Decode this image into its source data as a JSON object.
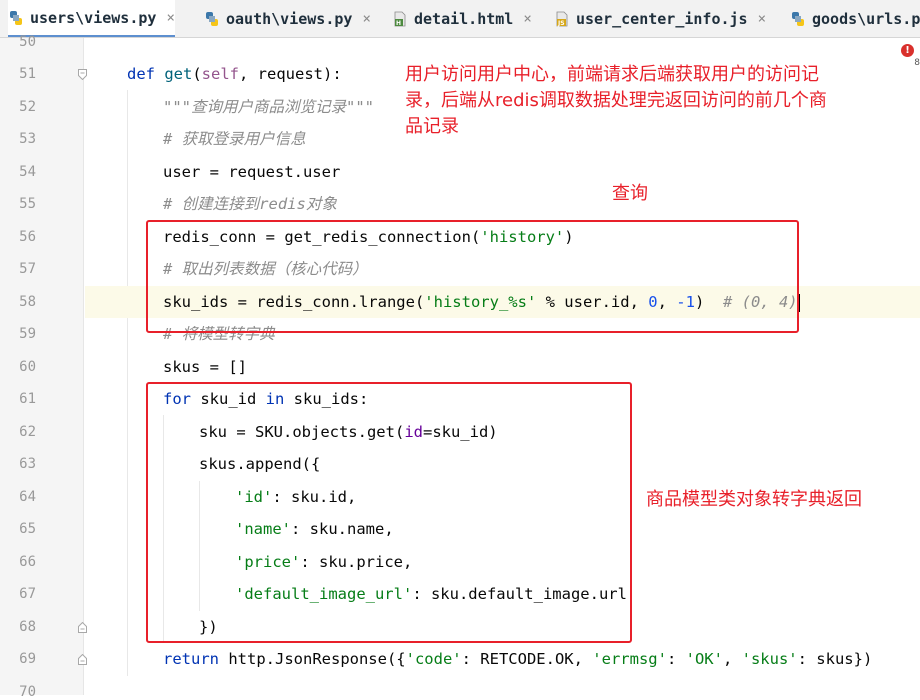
{
  "tabs": [
    {
      "label": "users\\views.py",
      "icon": "python-file-icon",
      "active": true
    },
    {
      "label": "oauth\\views.py",
      "icon": "python-file-icon"
    },
    {
      "label": "detail.html",
      "icon": "html-file-icon"
    },
    {
      "label": "user_center_info.js",
      "icon": "js-file-icon"
    },
    {
      "label": "goods\\urls.py",
      "icon": "python-file-icon"
    }
  ],
  "close_glyph": "×",
  "warning": {
    "glyph": "!",
    "count": "8"
  },
  "line_numbers": [
    "50",
    "51",
    "52",
    "53",
    "54",
    "55",
    "56",
    "57",
    "58",
    "59",
    "60",
    "61",
    "62",
    "63",
    "64",
    "65",
    "66",
    "67",
    "68",
    "69",
    "70"
  ],
  "code": {
    "l51": {
      "def": "def ",
      "name": "get",
      "p1": "(",
      "self": "self",
      "p2": ", request):"
    },
    "l52": {
      "doc": "\"\"\"查询用户商品浏览记录\"\"\""
    },
    "l53": {
      "cmt": "# 获取登录用户信息"
    },
    "l54": {
      "text": "user = request.user"
    },
    "l55": {
      "cmt": "# 创建连接到redis对象"
    },
    "l56": {
      "a": "redis_conn = get_redis_connection(",
      "s": "'history'",
      "b": ")"
    },
    "l57": {
      "cmt": "# 取出列表数据（核心代码）"
    },
    "l58": {
      "a": "sku_ids = redis_conn.lrange(",
      "s": "'history_%s'",
      "b": " % user.id, ",
      "n1": "0",
      "c": ", ",
      "n2": "-1",
      "d": ")  ",
      "cmt": "# (0, 4)"
    },
    "l59": {
      "cmt": "# 将模型转字典"
    },
    "l60": {
      "text": "skus = []"
    },
    "l61": {
      "kw1": "for",
      "a": " sku_id ",
      "kw2": "in",
      "b": " sku_ids:"
    },
    "l62": {
      "a": "sku = SKU.objects.get(",
      "p": "id",
      "b": "=sku_id)"
    },
    "l63": {
      "text": "skus.append({"
    },
    "l64": {
      "s": "'id'",
      "b": ": sku.id,"
    },
    "l65": {
      "s": "'name'",
      "b": ": sku.name,"
    },
    "l66": {
      "s": "'price'",
      "b": ": sku.price,"
    },
    "l67": {
      "s": "'default_image_url'",
      "b": ": sku.default_image.url"
    },
    "l68": {
      "text": "})"
    },
    "l69": {
      "kw": "return",
      "a": " http.JsonResponse({",
      "s1": "'code'",
      "b": ": RETCODE.OK, ",
      "s2": "'errmsg'",
      "c": ": ",
      "s3": "'OK'",
      "d": ", ",
      "s4": "'skus'",
      "e": ": skus})"
    }
  },
  "annotations": {
    "top_note": [
      "用户访问用户中心，前端请求后端获取用户的访问记",
      "录，后端从redis调取数据处理完返回访问的前几个商",
      "品记录"
    ],
    "query_note": "查询",
    "convert_note": "商品模型类对象转字典返回"
  },
  "colors": {
    "annotation": "#e8202a",
    "keyword": "#0033b3",
    "string": "#067d17",
    "comment": "#8c8c8c"
  }
}
